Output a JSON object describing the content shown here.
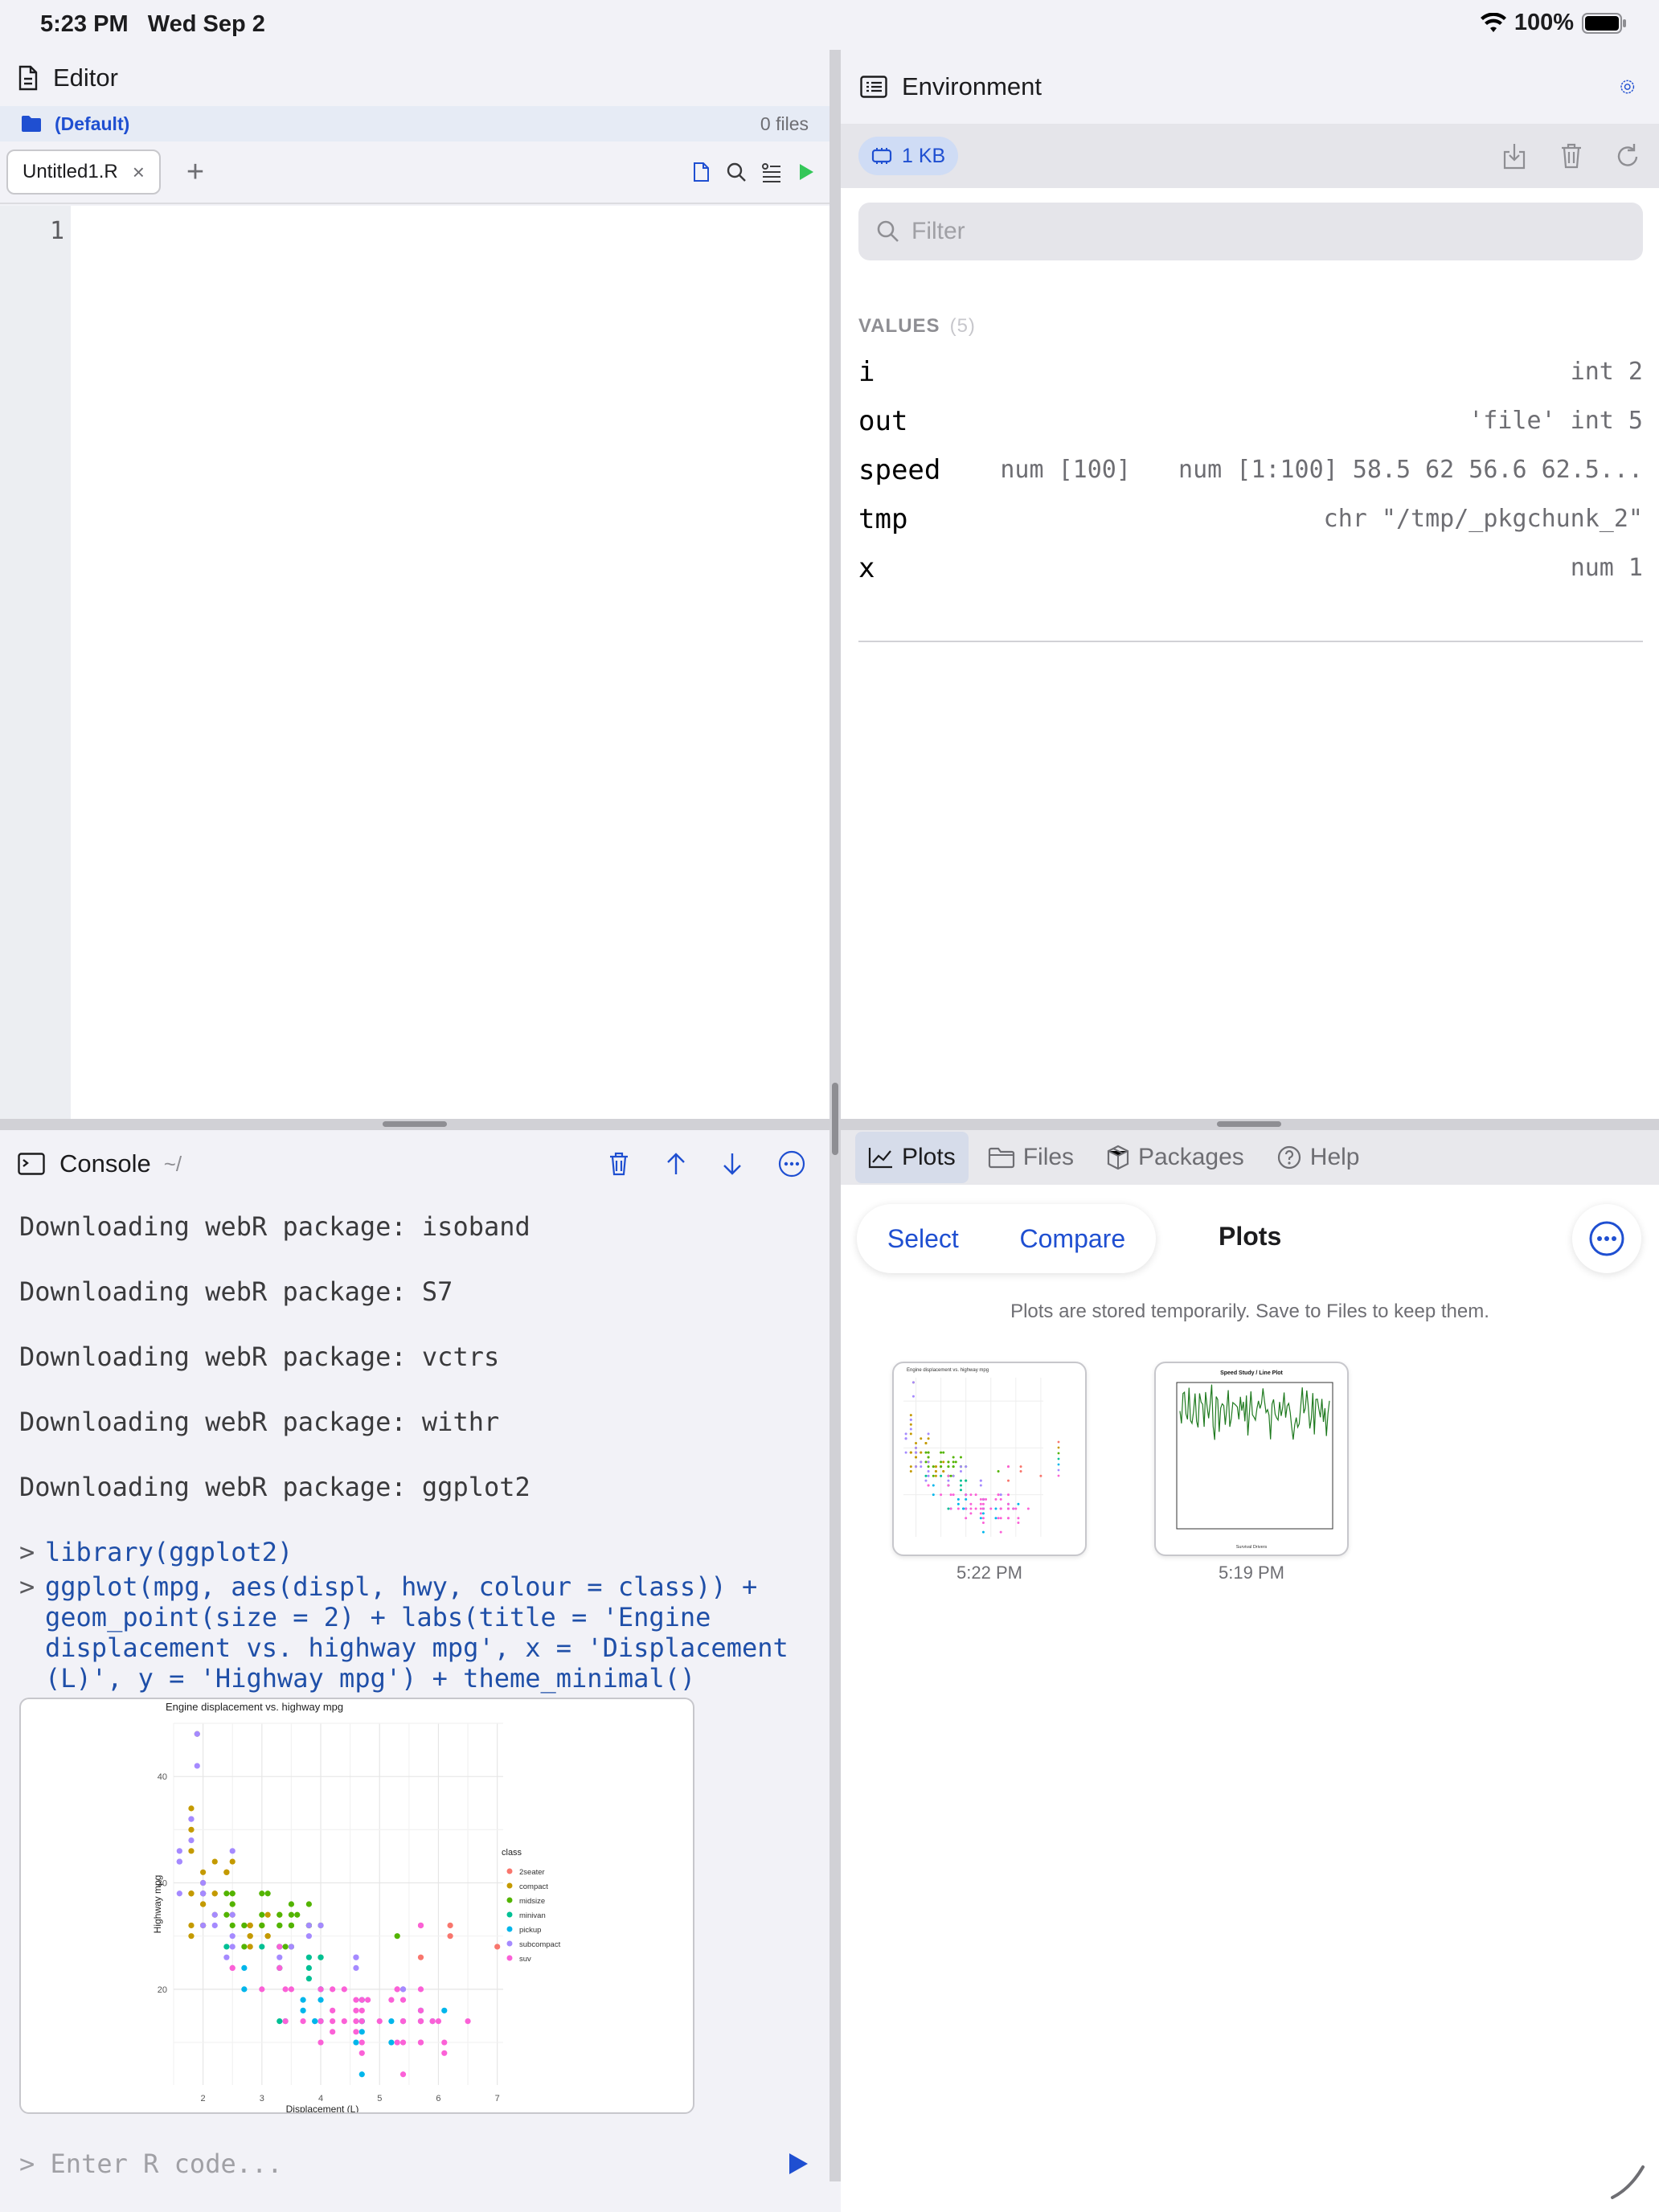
{
  "status": {
    "time": "5:23 PM",
    "date": "Wed Sep 2",
    "battery": "100%"
  },
  "editor": {
    "title": "Editor",
    "project": {
      "name": "(Default)",
      "count": "0 files"
    },
    "tabs": [
      {
        "label": "Untitled1.R",
        "close": "×"
      }
    ],
    "add_tab": "+",
    "line_numbers": [
      "1"
    ],
    "code": ""
  },
  "console": {
    "title": "Console",
    "path": "~/",
    "messages": [
      "Downloading webR package: isoband",
      "Downloading webR package: S7",
      "Downloading webR package: vctrs",
      "Downloading webR package: withr",
      "Downloading webR package: ggplot2"
    ],
    "prompt": ">",
    "commands": [
      [
        "library(ggplot2)"
      ],
      [
        "ggplot(mpg, aes(displ, hwy, colour = class)) +",
        "geom_point(size = 2) + labs(title = 'Engine",
        "displacement vs. highway mpg', x = 'Displacement",
        "(L)', y = 'Highway mpg') + theme_minimal()"
      ]
    ],
    "input_placeholder": "> Enter R code..."
  },
  "environment": {
    "title": "Environment",
    "memory": "1  KB",
    "filter_placeholder": "Filter",
    "section": "VALUES",
    "section_count": "(5)",
    "values": [
      {
        "name": "i",
        "mid": "",
        "value": "int 2"
      },
      {
        "name": "out",
        "mid": "",
        "value": "'file' int 5"
      },
      {
        "name": "speed",
        "mid": "num [100]",
        "value": "num [1:100] 58.5 62 56.6 62.5..."
      },
      {
        "name": "tmp",
        "mid": "",
        "value": "chr \"/tmp/_pkgchunk_2\""
      },
      {
        "name": "x",
        "mid": "",
        "value": "num 1"
      }
    ]
  },
  "plots_panel": {
    "tabs": [
      "Plots",
      "Files",
      "Packages",
      "Help"
    ],
    "select": "Select",
    "compare": "Compare",
    "title": "Plots",
    "note": "Plots are stored temporarily. Save to Files to keep them.",
    "thumbs": [
      {
        "time": "5:22 PM",
        "title": "Engine displacement vs. highway mpg"
      },
      {
        "time": "5:19 PM",
        "title": "Speed Study / Line Plot",
        "xlabel": "Survival Drivers"
      }
    ]
  },
  "colors": {
    "accent": "#1f4fd1",
    "run_green": "#34c759",
    "console_cmd": "#1f4fa8"
  },
  "chart_data": {
    "type": "scatter",
    "title": "Engine displacement vs. highway mpg",
    "xlabel": "Displacement (L)",
    "ylabel": "Highway mpg",
    "xlim": [
      1.5,
      7.1
    ],
    "ylim": [
      11,
      45
    ],
    "xticks": [
      2,
      3,
      4,
      5,
      6,
      7
    ],
    "yticks": [
      20,
      30,
      40
    ],
    "legend_title": "class",
    "legend_position": "right",
    "series": [
      {
        "name": "2seater",
        "color": "#F8766D",
        "points": [
          [
            5.7,
            26
          ],
          [
            5.7,
            23
          ],
          [
            6.2,
            26
          ],
          [
            6.2,
            25
          ],
          [
            7.0,
            24
          ]
        ]
      },
      {
        "name": "compact",
        "color": "#C49A00",
        "points": [
          [
            1.8,
            29
          ],
          [
            1.8,
            29
          ],
          [
            2.0,
            31
          ],
          [
            2.0,
            30
          ],
          [
            2.8,
            26
          ],
          [
            2.8,
            26
          ],
          [
            3.1,
            27
          ],
          [
            1.8,
            26
          ],
          [
            1.8,
            25
          ],
          [
            2.0,
            28
          ],
          [
            2.0,
            29
          ],
          [
            2.8,
            25
          ],
          [
            2.8,
            25
          ],
          [
            3.1,
            25
          ],
          [
            3.1,
            25
          ],
          [
            2.2,
            27
          ],
          [
            2.2,
            29
          ],
          [
            2.4,
            31
          ],
          [
            2.4,
            31
          ],
          [
            3.0,
            26
          ],
          [
            3.0,
            26
          ],
          [
            3.3,
            27
          ],
          [
            1.8,
            29
          ],
          [
            1.8,
            33
          ],
          [
            2.0,
            29
          ],
          [
            1.9,
            44
          ],
          [
            2.0,
            26
          ],
          [
            2.5,
            28
          ],
          [
            2.5,
            29
          ],
          [
            2.2,
            29
          ],
          [
            2.2,
            32
          ],
          [
            2.5,
            32
          ],
          [
            2.5,
            27
          ],
          [
            1.8,
            37
          ],
          [
            1.8,
            35
          ],
          [
            2.0,
            26
          ],
          [
            2.0,
            29
          ],
          [
            2.8,
            24
          ],
          [
            2.8,
            26
          ],
          [
            2.0,
            28
          ],
          [
            2.7,
            26
          ],
          [
            2.4,
            31
          ]
        ]
      },
      {
        "name": "midsize",
        "color": "#53B400",
        "points": [
          [
            2.4,
            27
          ],
          [
            3.0,
            26
          ],
          [
            3.3,
            26
          ],
          [
            3.3,
            27
          ],
          [
            2.4,
            29
          ],
          [
            2.5,
            29
          ],
          [
            3.3,
            26
          ],
          [
            3.1,
            29
          ],
          [
            3.6,
            27
          ],
          [
            3.5,
            26
          ],
          [
            3.8,
            26
          ],
          [
            3.8,
            26
          ],
          [
            5.3,
            25
          ],
          [
            3.5,
            27
          ],
          [
            3.5,
            28
          ],
          [
            2.5,
            26
          ],
          [
            2.5,
            28
          ],
          [
            3.5,
            26
          ],
          [
            3.0,
            27
          ],
          [
            2.7,
            26
          ],
          [
            3.5,
            24
          ],
          [
            3.8,
            26
          ],
          [
            3.8,
            28
          ],
          [
            4.0,
            26
          ],
          [
            3.0,
            29
          ],
          [
            2.7,
            24
          ],
          [
            3.4,
            24
          ],
          [
            4.0,
            23
          ]
        ]
      },
      {
        "name": "minivan",
        "color": "#00C094",
        "points": [
          [
            2.4,
            24
          ],
          [
            3.0,
            24
          ],
          [
            3.3,
            22
          ],
          [
            3.3,
            22
          ],
          [
            3.3,
            24
          ],
          [
            3.3,
            24
          ],
          [
            3.3,
            17
          ],
          [
            3.8,
            22
          ],
          [
            3.8,
            21
          ],
          [
            3.8,
            23
          ],
          [
            4.0,
            23
          ]
        ]
      },
      {
        "name": "pickup",
        "color": "#00B6EB",
        "points": [
          [
            3.7,
            19
          ],
          [
            3.7,
            18
          ],
          [
            3.9,
            17
          ],
          [
            3.9,
            17
          ],
          [
            4.7,
            19
          ],
          [
            4.7,
            19
          ],
          [
            4.7,
            17
          ],
          [
            5.2,
            17
          ],
          [
            5.2,
            15
          ],
          [
            5.7,
            17
          ],
          [
            5.9,
            17
          ],
          [
            4.7,
            12
          ],
          [
            4.7,
            17
          ],
          [
            4.7,
            17
          ],
          [
            4.7,
            16
          ],
          [
            5.7,
            18
          ],
          [
            6.1,
            18
          ],
          [
            4.0,
            20
          ],
          [
            4.0,
            17
          ],
          [
            4.0,
            17
          ],
          [
            4.6,
            15
          ],
          [
            5.4,
            17
          ],
          [
            2.7,
            20
          ],
          [
            2.7,
            22
          ],
          [
            3.4,
            17
          ],
          [
            4.0,
            19
          ],
          [
            4.0,
            20
          ],
          [
            4.7,
            17
          ]
        ]
      },
      {
        "name": "subcompact",
        "color": "#A58AFF",
        "points": [
          [
            1.6,
            33
          ],
          [
            1.6,
            32
          ],
          [
            1.6,
            32
          ],
          [
            1.6,
            29
          ],
          [
            1.6,
            32
          ],
          [
            1.8,
            34
          ],
          [
            1.8,
            36
          ],
          [
            1.8,
            36
          ],
          [
            2.0,
            29
          ],
          [
            1.9,
            44
          ],
          [
            1.9,
            41
          ],
          [
            2.4,
            23
          ],
          [
            2.5,
            24
          ],
          [
            4.6,
            23
          ],
          [
            4.6,
            22
          ],
          [
            5.4,
            20
          ],
          [
            3.8,
            26
          ],
          [
            3.8,
            25
          ],
          [
            2.0,
            29
          ],
          [
            2.0,
            26
          ],
          [
            2.5,
            27
          ],
          [
            2.5,
            25
          ],
          [
            2.2,
            27
          ],
          [
            2.2,
            26
          ],
          [
            2.0,
            30
          ],
          [
            2.5,
            33
          ],
          [
            3.3,
            23
          ],
          [
            3.5,
            24
          ],
          [
            4.0,
            26
          ],
          [
            4.6,
            23
          ],
          [
            5.4,
            20
          ],
          [
            2.0,
            29
          ]
        ]
      },
      {
        "name": "suv",
        "color": "#FB61D7",
        "points": [
          [
            5.3,
            20
          ],
          [
            5.3,
            15
          ],
          [
            5.3,
            20
          ],
          [
            5.7,
            17
          ],
          [
            6.0,
            17
          ],
          [
            5.7,
            26
          ],
          [
            6.5,
            17
          ],
          [
            4.0,
            20
          ],
          [
            4.7,
            19
          ],
          [
            4.7,
            15
          ],
          [
            4.7,
            18
          ],
          [
            4.2,
            17
          ],
          [
            4.6,
            17
          ],
          [
            4.6,
            18
          ],
          [
            5.4,
            19
          ],
          [
            5.4,
            17
          ],
          [
            3.0,
            20
          ],
          [
            3.7,
            17
          ],
          [
            4.0,
            15
          ],
          [
            4.7,
            17
          ],
          [
            5.7,
            15
          ],
          [
            6.1,
            14
          ],
          [
            4.6,
            16
          ],
          [
            5.4,
            15
          ],
          [
            4.2,
            18
          ],
          [
            4.4,
            20
          ],
          [
            2.5,
            22
          ],
          [
            2.5,
            22
          ],
          [
            3.3,
            22
          ],
          [
            3.3,
            24
          ],
          [
            5.7,
            18
          ],
          [
            3.5,
            20
          ],
          [
            3.4,
            17
          ],
          [
            3.4,
            20
          ],
          [
            4.4,
            17
          ],
          [
            4.0,
            17
          ],
          [
            4.8,
            19
          ],
          [
            4.7,
            14
          ],
          [
            5.0,
            17
          ],
          [
            5.4,
            12
          ],
          [
            5.7,
            15
          ],
          [
            4.2,
            20
          ],
          [
            4.2,
            16
          ],
          [
            4.6,
            19
          ],
          [
            5.4,
            17
          ],
          [
            5.2,
            19
          ],
          [
            5.7,
            17
          ],
          [
            5.7,
            20
          ],
          [
            5.9,
            17
          ],
          [
            6.1,
            15
          ]
        ]
      }
    ]
  }
}
